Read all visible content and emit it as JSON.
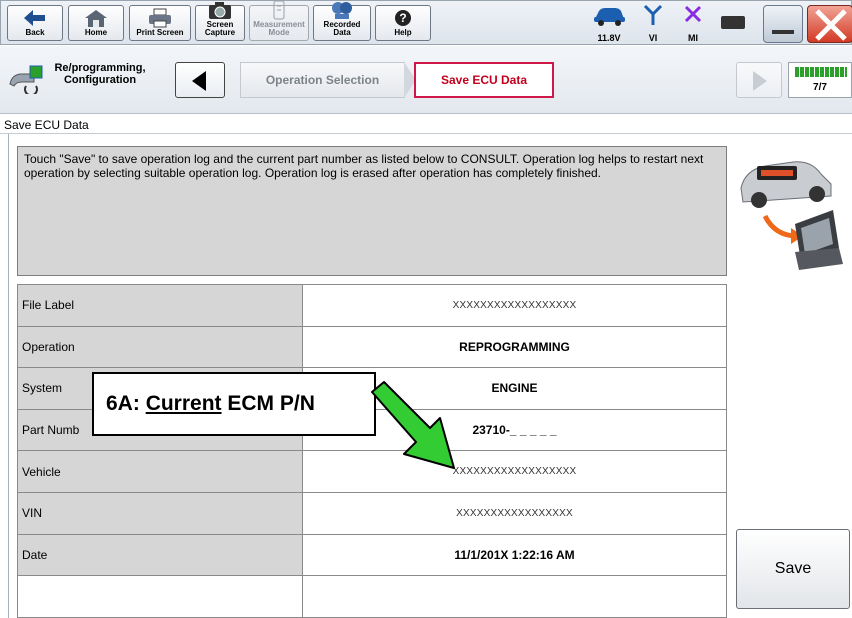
{
  "toolbar": {
    "buttons": [
      {
        "label": "Back",
        "icon": "back-arrow-icon"
      },
      {
        "label": "Home",
        "icon": "home-icon"
      },
      {
        "label": "Print Screen",
        "icon": "printer-icon"
      },
      {
        "label": "Screen\nCapture",
        "icon": "camera-icon"
      },
      {
        "label": "Measurement\nMode",
        "icon": "measurement-icon",
        "disabled": true
      },
      {
        "label": "Recorded\nData",
        "icon": "recorded-data-icon"
      },
      {
        "label": "Help",
        "icon": "help-icon"
      }
    ],
    "voltage": "11.8V",
    "vi_label": "VI",
    "mi_label": "MI"
  },
  "breadcrumb": {
    "mode_label": "Re/programming,\nConfiguration",
    "steps": [
      "Operation Selection",
      "Save ECU Data"
    ],
    "progress": "7/7",
    "progress_fraction": 1.0
  },
  "page": {
    "title": "Save ECU Data",
    "instruction": "Touch \"Save\" to save operation log and the current part number as listed below to CONSULT. Operation log helps to restart next operation by selecting suitable operation log. Operation log is erased after operation has completely finished."
  },
  "table": {
    "rows": [
      {
        "label": "File Label",
        "value": "XXXXXXXXXXXXXXXXXX",
        "thin": true
      },
      {
        "label": "Operation",
        "value": "REPROGRAMMING"
      },
      {
        "label": "System",
        "value": "ENGINE"
      },
      {
        "label": "Part Numb",
        "value": "23710-_ _ _ _ _"
      },
      {
        "label": "Vehicle",
        "value": "XXXXXXXXXXXXXXXXXX",
        "thin": true
      },
      {
        "label": "VIN",
        "value": "XXXXXXXXXXXXXXXXX",
        "thin": true
      },
      {
        "label": "Date",
        "value": "11/1/201X 1:22:16 AM"
      },
      {
        "label": "",
        "value": ""
      }
    ]
  },
  "save_label": "Save",
  "callout": {
    "prefix": "6A: ",
    "underlined": "Current",
    "suffix": " ECM P/N"
  },
  "colors": {
    "active_step": "#d0174a",
    "progress": "#2aa02a",
    "arrow": "#33cc33",
    "close": "#d23a25"
  }
}
